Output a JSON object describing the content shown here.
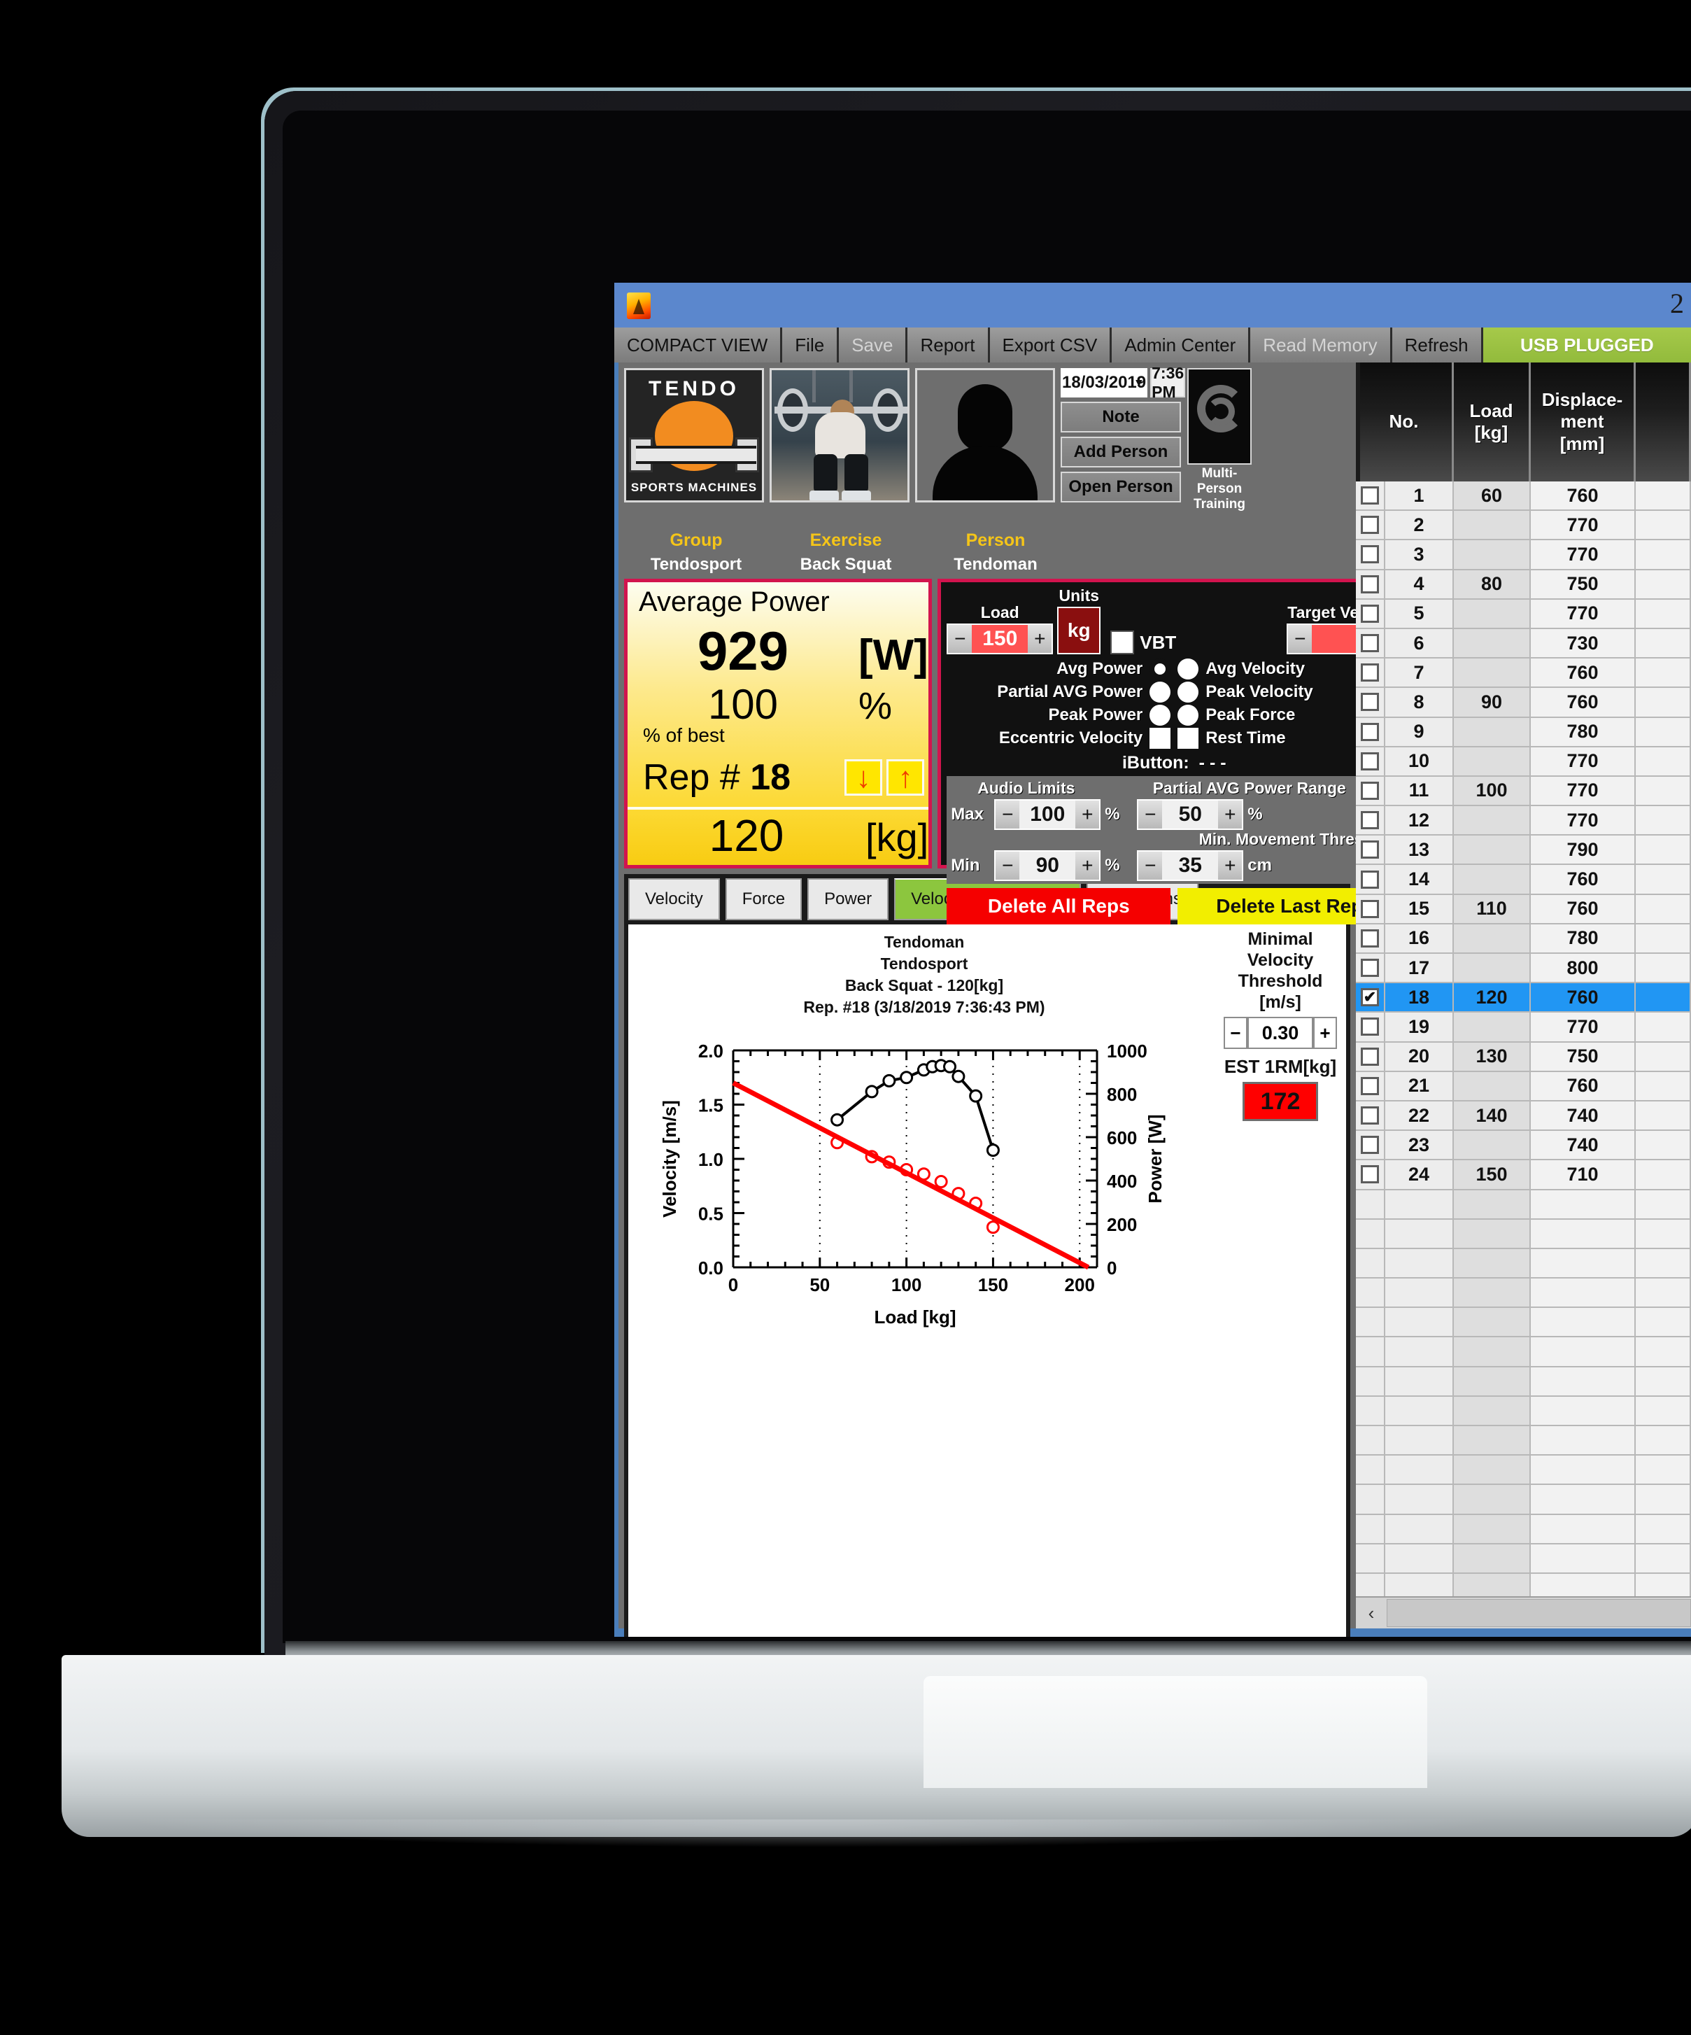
{
  "window": {
    "title": "2",
    "app_icon": "flame-icon"
  },
  "toolbar": {
    "items": [
      {
        "label": "COMPACT VIEW",
        "state": "normal"
      },
      {
        "label": "File",
        "state": "normal"
      },
      {
        "label": "Save",
        "state": "disabled"
      },
      {
        "label": "Report",
        "state": "normal"
      },
      {
        "label": "Export CSV",
        "state": "normal"
      },
      {
        "label": "Admin Center",
        "state": "normal"
      },
      {
        "label": "Read Memory",
        "state": "disabled"
      },
      {
        "label": "Refresh",
        "state": "normal"
      }
    ],
    "usb_status": "USB PLUGGED"
  },
  "header": {
    "group_label": "Group",
    "group_value": "Tendosport",
    "exercise_label": "Exercise",
    "exercise_value": "Back Squat",
    "person_label": "Person",
    "person_value": "Tendoman",
    "date": "18/03/2019",
    "time": "7:36 PM",
    "note_button": "Note",
    "add_person_button": "Add Person",
    "open_person_button": "Open Person",
    "multi_person_label": "Multi-Person",
    "multi_person_label2": "Training",
    "logo_word": "TENDO",
    "logo_sub": "SPORTS MACHINES"
  },
  "metric": {
    "title": "Average Power",
    "value": "929",
    "unit": "[W]",
    "percent": "100",
    "percent_unit": "%",
    "percent_note": "% of best",
    "rep_label": "Rep #",
    "rep_number": "18",
    "down_arrow": "↓",
    "up_arrow": "↑",
    "load_value": "120",
    "load_unit": "[kg]"
  },
  "settings": {
    "load_label": "Load",
    "load_value": "150",
    "units_label": "Units",
    "units_value": "kg",
    "vbt_label": "VBT",
    "vbt_checked": false,
    "target_velocity_label": "Target Velocity",
    "target_velocity_value": "",
    "minus": "−",
    "plus": "+",
    "radios": [
      {
        "left_label": "Avg Power",
        "left_type": "radio",
        "left_selected": true,
        "right_label": "Avg Velocity",
        "right_type": "radio",
        "right_selected": false
      },
      {
        "left_label": "Partial AVG Power",
        "left_type": "radio",
        "left_selected": false,
        "right_label": "Peak Velocity",
        "right_type": "radio",
        "right_selected": false
      },
      {
        "left_label": "Peak Power",
        "left_type": "radio",
        "left_selected": false,
        "right_label": "Peak Force",
        "right_type": "radio",
        "right_selected": false
      },
      {
        "left_label": "Eccentric Velocity",
        "left_type": "check",
        "left_selected": false,
        "right_label": "Rest Time",
        "right_type": "check",
        "right_selected": false
      }
    ],
    "ibutton_label": "iButton:",
    "ibutton_value": "- - -",
    "audio_limits_label": "Audio Limits",
    "partial_range_label": "Partial AVG Power Range",
    "min_movement_label": "Min. Movement Threshold",
    "max_label": "Max",
    "max_value": "100",
    "max_unit": "%",
    "partial_value": "50",
    "partial_unit": "%",
    "min_label": "Min",
    "min_value": "90",
    "min_unit": "%",
    "threshold_value": "35",
    "threshold_unit": "cm",
    "delete_all": "Delete All Reps",
    "delete_last": "Delete Last Rep"
  },
  "graph": {
    "tabs": [
      {
        "label": "Velocity",
        "active": false
      },
      {
        "label": "Force",
        "active": false
      },
      {
        "label": "Power",
        "active": false
      },
      {
        "label": "Velocity  Power-Load",
        "active": true
      },
      {
        "label": "All Graphs",
        "active": false
      }
    ],
    "mvt_label_1": "Minimal Velocity",
    "mvt_label_2": "Threshold [m/s]",
    "mvt_value": "0.30",
    "est_label": "EST 1RM[kg]",
    "est_value": "172",
    "minus": "−",
    "plus": "+"
  },
  "chart_data": {
    "type": "line",
    "title_lines": [
      "Tendoman",
      "Tendosport",
      "Back  Squat - 120[kg]",
      "Rep. #18    (3/18/2019 7:36:43 PM)"
    ],
    "xlabel": "Load [kg]",
    "ylabel": "Velocity [m/s]",
    "y2label": "Power [W]",
    "xlim": [
      0,
      210
    ],
    "xticks": [
      0,
      50,
      100,
      150,
      200
    ],
    "ylim": [
      0.0,
      2.0
    ],
    "yticks": [
      "0.0",
      "0.5",
      "1.0",
      "1.5",
      "2.0"
    ],
    "y2lim": [
      0,
      1000
    ],
    "y2ticks": [
      0,
      200,
      400,
      600,
      800,
      1000
    ],
    "grid": "vertical-dotted",
    "series": [
      {
        "name": "Power [W]",
        "color": "#000000",
        "marker": "open-circle",
        "line": true,
        "axis": "right",
        "x": [
          60,
          80,
          90,
          100,
          110,
          115,
          120,
          125,
          130,
          140,
          150
        ],
        "y": [
          680,
          810,
          860,
          875,
          910,
          925,
          930,
          925,
          880,
          790,
          540
        ]
      },
      {
        "name": "Velocity [m/s]",
        "color": "#ff0000",
        "marker": "open-circle",
        "line": false,
        "axis": "left",
        "x": [
          60,
          80,
          90,
          100,
          110,
          120,
          130,
          140,
          150
        ],
        "y": [
          1.15,
          1.02,
          0.97,
          0.9,
          0.86,
          0.79,
          0.68,
          0.59,
          0.37
        ]
      },
      {
        "name": "Velocity fit",
        "color": "#ff0000",
        "marker": "none",
        "line": true,
        "axis": "left",
        "x": [
          0,
          205
        ],
        "y": [
          1.7,
          0.0
        ]
      }
    ]
  },
  "table": {
    "columns": [
      "No.",
      "Load\n[kg]",
      "Displace-\nment\n[mm]",
      ""
    ],
    "col_no": "No.",
    "col_load_1": "Load",
    "col_load_2": "[kg]",
    "col_disp_1": "Displace-",
    "col_disp_2": "ment",
    "col_disp_3": "[mm]",
    "rows": [
      {
        "checked": false,
        "no": "1",
        "load": "60",
        "disp": "760",
        "selected": false
      },
      {
        "checked": false,
        "no": "2",
        "load": "",
        "disp": "770",
        "selected": false
      },
      {
        "checked": false,
        "no": "3",
        "load": "",
        "disp": "770",
        "selected": false
      },
      {
        "checked": false,
        "no": "4",
        "load": "80",
        "disp": "750",
        "selected": false
      },
      {
        "checked": false,
        "no": "5",
        "load": "",
        "disp": "770",
        "selected": false
      },
      {
        "checked": false,
        "no": "6",
        "load": "",
        "disp": "730",
        "selected": false
      },
      {
        "checked": false,
        "no": "7",
        "load": "",
        "disp": "760",
        "selected": false
      },
      {
        "checked": false,
        "no": "8",
        "load": "90",
        "disp": "760",
        "selected": false
      },
      {
        "checked": false,
        "no": "9",
        "load": "",
        "disp": "780",
        "selected": false
      },
      {
        "checked": false,
        "no": "10",
        "load": "",
        "disp": "770",
        "selected": false
      },
      {
        "checked": false,
        "no": "11",
        "load": "100",
        "disp": "770",
        "selected": false
      },
      {
        "checked": false,
        "no": "12",
        "load": "",
        "disp": "770",
        "selected": false
      },
      {
        "checked": false,
        "no": "13",
        "load": "",
        "disp": "790",
        "selected": false
      },
      {
        "checked": false,
        "no": "14",
        "load": "",
        "disp": "760",
        "selected": false
      },
      {
        "checked": false,
        "no": "15",
        "load": "110",
        "disp": "760",
        "selected": false
      },
      {
        "checked": false,
        "no": "16",
        "load": "",
        "disp": "780",
        "selected": false
      },
      {
        "checked": false,
        "no": "17",
        "load": "",
        "disp": "800",
        "selected": false
      },
      {
        "checked": true,
        "no": "18",
        "load": "120",
        "disp": "760",
        "selected": true
      },
      {
        "checked": false,
        "no": "19",
        "load": "",
        "disp": "770",
        "selected": false
      },
      {
        "checked": false,
        "no": "20",
        "load": "130",
        "disp": "750",
        "selected": false
      },
      {
        "checked": false,
        "no": "21",
        "load": "",
        "disp": "760",
        "selected": false
      },
      {
        "checked": false,
        "no": "22",
        "load": "140",
        "disp": "740",
        "selected": false
      },
      {
        "checked": false,
        "no": "23",
        "load": "",
        "disp": "740",
        "selected": false
      },
      {
        "checked": false,
        "no": "24",
        "load": "150",
        "disp": "710",
        "selected": false
      },
      {
        "checked": null,
        "no": "",
        "load": "",
        "disp": "",
        "selected": false
      },
      {
        "checked": null,
        "no": "",
        "load": "",
        "disp": "",
        "selected": false
      },
      {
        "checked": null,
        "no": "",
        "load": "",
        "disp": "",
        "selected": false
      },
      {
        "checked": null,
        "no": "",
        "load": "",
        "disp": "",
        "selected": false
      },
      {
        "checked": null,
        "no": "",
        "load": "",
        "disp": "",
        "selected": false
      },
      {
        "checked": null,
        "no": "",
        "load": "",
        "disp": "",
        "selected": false
      },
      {
        "checked": null,
        "no": "",
        "load": "",
        "disp": "",
        "selected": false
      },
      {
        "checked": null,
        "no": "",
        "load": "",
        "disp": "",
        "selected": false
      },
      {
        "checked": null,
        "no": "",
        "load": "",
        "disp": "",
        "selected": false
      },
      {
        "checked": null,
        "no": "",
        "load": "",
        "disp": "",
        "selected": false
      },
      {
        "checked": null,
        "no": "",
        "load": "",
        "disp": "",
        "selected": false
      },
      {
        "checked": null,
        "no": "",
        "load": "",
        "disp": "",
        "selected": false
      },
      {
        "checked": null,
        "no": "",
        "load": "",
        "disp": "",
        "selected": false
      },
      {
        "checked": null,
        "no": "",
        "load": "",
        "disp": "",
        "selected": false
      }
    ],
    "scroll_left_arrow": "‹"
  },
  "colors": {
    "usb_green": "#92bb3c",
    "accent_pink": "#d2144e",
    "selected_row": "#2196f3",
    "est_red": "#ff0000",
    "tab_green": "#8cc63e",
    "yellow_panel": "#fcd933"
  }
}
